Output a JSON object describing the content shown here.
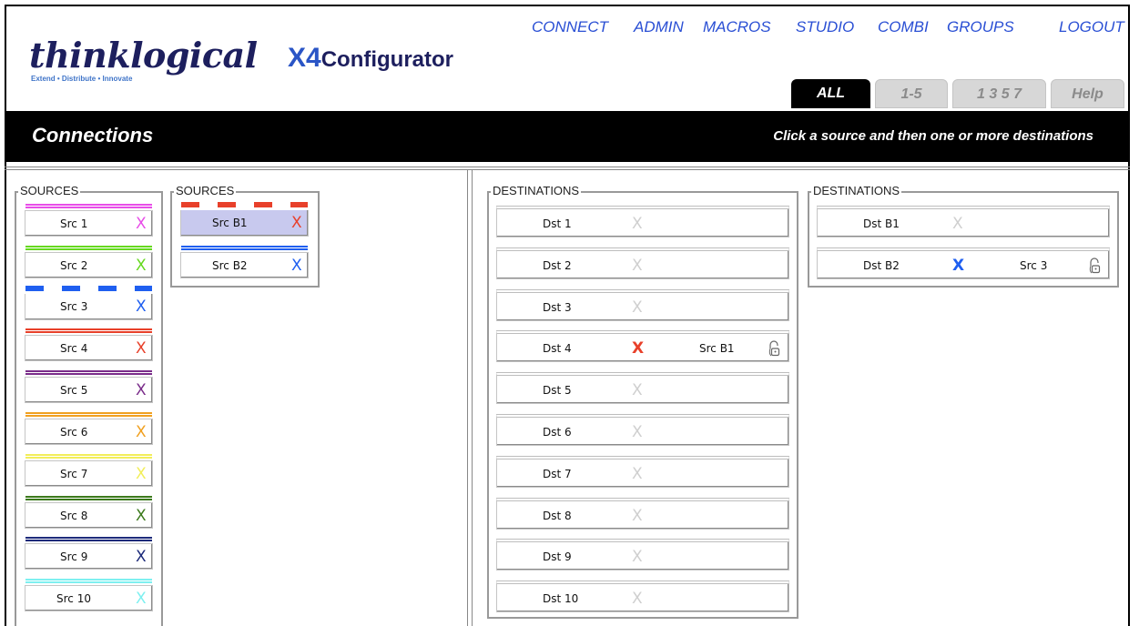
{
  "logo": {
    "brand": "thinklogical",
    "tagline": "Extend • Distribute • Innovate",
    "product_prefix": "X4",
    "product_suffix": "Configurator"
  },
  "nav": [
    "CONNECT",
    "ADMIN",
    "MACROS",
    "STUDIO",
    "COMBI",
    "GROUPS",
    "LOGOUT"
  ],
  "tabs": [
    {
      "label": "ALL",
      "active": true
    },
    {
      "label": "1-5",
      "active": false
    },
    {
      "label": "1 3 5 7",
      "active": false
    },
    {
      "label": "Help",
      "active": false
    }
  ],
  "page_title": "Connections",
  "instruction": "Click a source and then one or more destinations",
  "source_group_1": {
    "label": "SOURCES",
    "items": [
      {
        "label": "Src 1",
        "color": "#e84de8",
        "bar": "line"
      },
      {
        "label": "Src 2",
        "color": "#66d91f",
        "bar": "line"
      },
      {
        "label": "Src 3",
        "color": "#1f5ff0",
        "bar": "dashed"
      },
      {
        "label": "Src 4",
        "color": "#e8402a",
        "bar": "line"
      },
      {
        "label": "Src 5",
        "color": "#7a2d8a",
        "bar": "line"
      },
      {
        "label": "Src 6",
        "color": "#f0a020",
        "bar": "line"
      },
      {
        "label": "Src 7",
        "color": "#f2ee5a",
        "bar": "line"
      },
      {
        "label": "Src 8",
        "color": "#3c7a1c",
        "bar": "line"
      },
      {
        "label": "Src 9",
        "color": "#1c2a7a",
        "bar": "line"
      },
      {
        "label": "Src 10",
        "color": "#7ef0f0",
        "bar": "line"
      }
    ]
  },
  "source_group_2": {
    "label": "SOURCES",
    "items": [
      {
        "label": "Src B1",
        "color": "#e8402a",
        "bar": "dashed",
        "selected": true
      },
      {
        "label": "Src B2",
        "color": "#1f5ff0",
        "bar": "line"
      }
    ]
  },
  "dest_group_1": {
    "label": "DESTINATIONS",
    "items": [
      {
        "label": "Dst 1",
        "connected": "",
        "x_color": "#cfcfcf"
      },
      {
        "label": "Dst 2",
        "connected": "",
        "x_color": "#cfcfcf"
      },
      {
        "label": "Dst 3",
        "connected": "",
        "x_color": "#cfcfcf"
      },
      {
        "label": "Dst 4",
        "connected": "Src B1",
        "x_color": "#e8402a",
        "locked_icon": "lock-icon"
      },
      {
        "label": "Dst 5",
        "connected": "",
        "x_color": "#cfcfcf"
      },
      {
        "label": "Dst 6",
        "connected": "",
        "x_color": "#cfcfcf"
      },
      {
        "label": "Dst 7",
        "connected": "",
        "x_color": "#cfcfcf"
      },
      {
        "label": "Dst 8",
        "connected": "",
        "x_color": "#cfcfcf"
      },
      {
        "label": "Dst 9",
        "connected": "",
        "x_color": "#cfcfcf"
      },
      {
        "label": "Dst 10",
        "connected": "",
        "x_color": "#cfcfcf"
      }
    ]
  },
  "dest_group_2": {
    "label": "DESTINATIONS",
    "items": [
      {
        "label": "Dst B1",
        "connected": "",
        "x_color": "#cfcfcf"
      },
      {
        "label": "Dst B2",
        "connected": "Src 3",
        "x_color": "#1f5ff0",
        "locked_icon": "lock-icon"
      }
    ]
  },
  "x_glyph": "X"
}
